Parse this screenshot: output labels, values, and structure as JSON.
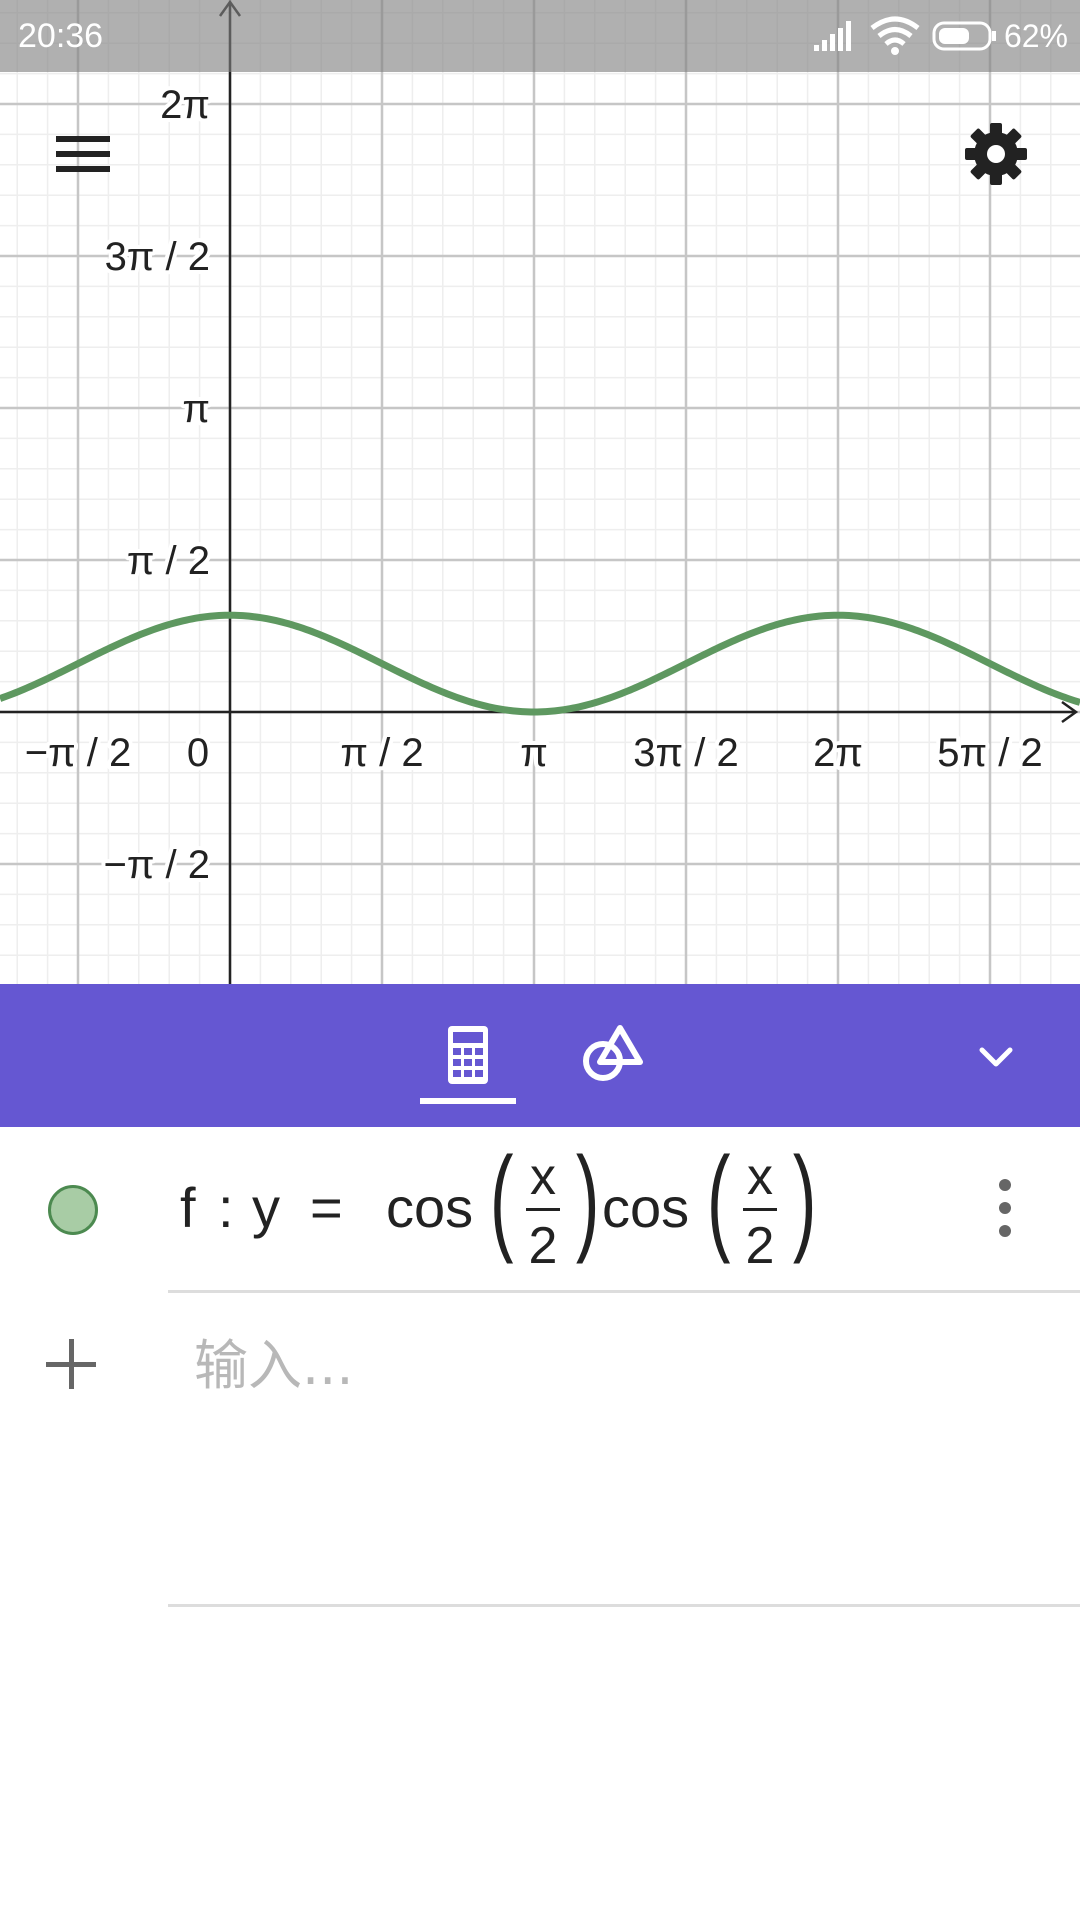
{
  "status_bar": {
    "time": "20:36",
    "battery_percent": "62%",
    "icons": [
      "signal-icon",
      "wifi-icon",
      "battery-icon"
    ]
  },
  "graph": {
    "menu_icon": "hamburger-menu-icon",
    "settings_icon": "gear-icon",
    "curve_color": "#5E9860",
    "x_ticks": [
      {
        "label": "−π / 2",
        "value": -1.5708
      },
      {
        "label": "0",
        "value": 0
      },
      {
        "label": "π / 2",
        "value": 1.5708
      },
      {
        "label": "π",
        "value": 3.1416
      },
      {
        "label": "3π / 2",
        "value": 4.7124
      },
      {
        "label": "2π",
        "value": 6.2832
      },
      {
        "label": "5π / 2",
        "value": 7.854
      }
    ],
    "y_ticks": [
      {
        "label": "2π",
        "value": 6.2832
      },
      {
        "label": "3π / 2",
        "value": 4.7124
      },
      {
        "label": "π",
        "value": 3.1416
      },
      {
        "label": "π / 2",
        "value": 1.5708
      },
      {
        "label": "−π / 2",
        "value": -1.5708
      }
    ]
  },
  "chart_data": {
    "type": "line",
    "series": [
      {
        "name": "f",
        "function": "cos(x/2)·cos(x/2)",
        "color": "#5E9860"
      }
    ],
    "xlim": [
      -2.36,
      8.73
    ],
    "ylim": [
      -2.8,
      7.3
    ],
    "grid": true
  },
  "toolbar": {
    "background": "#6557D2",
    "tabs": [
      {
        "name": "algebra",
        "icon": "calculator-icon",
        "active": true
      },
      {
        "name": "tools",
        "icon": "shapes-icon",
        "active": false
      }
    ],
    "collapse_icon": "chevron-down-icon"
  },
  "algebra": {
    "rows": [
      {
        "name": "f",
        "colon": ":",
        "lhs": "y",
        "eq": "=",
        "fn1": "cos",
        "fn2": "cos",
        "num": "x",
        "den": "2",
        "visible": true,
        "color": "#A8CCA5"
      }
    ],
    "input_placeholder": "输入..."
  }
}
